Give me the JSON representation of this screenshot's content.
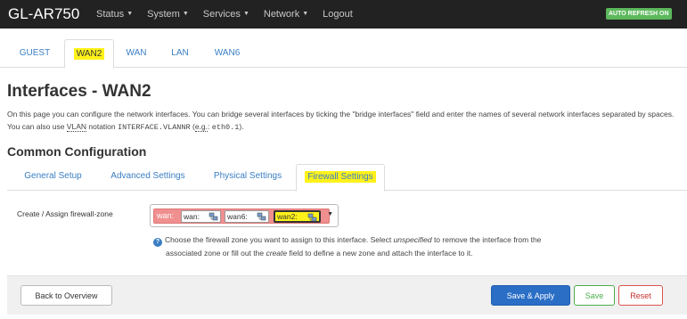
{
  "navbar": {
    "brand": "GL-AR750",
    "menu": [
      {
        "label": "Status",
        "dropdown": true
      },
      {
        "label": "System",
        "dropdown": true
      },
      {
        "label": "Services",
        "dropdown": true
      },
      {
        "label": "Network",
        "dropdown": true
      },
      {
        "label": "Logout",
        "dropdown": false
      }
    ],
    "auto_refresh": "AUTO REFRESH ON"
  },
  "interface_tabs": [
    {
      "label": "GUEST",
      "active": false
    },
    {
      "label": "WAN2",
      "active": true
    },
    {
      "label": "WAN",
      "active": false
    },
    {
      "label": "LAN",
      "active": false
    },
    {
      "label": "WAN6",
      "active": false
    }
  ],
  "page": {
    "title": "Interfaces - WAN2",
    "desc_part1": "On this page you can configure the network interfaces. You can bridge several interfaces by ticking the \"bridge interfaces\" field and enter the names of several network interfaces separated by spaces. You can also use ",
    "desc_vlan": "VLAN",
    "desc_part2": " notation ",
    "desc_notation": "INTERFACE.VLANNR",
    "desc_part3": " (",
    "desc_eg": "e.g.",
    "desc_part4": ": ",
    "desc_example": "eth0.1",
    "desc_part5": ")."
  },
  "section": {
    "title": "Common Configuration",
    "tabs": [
      {
        "label": "General Setup",
        "active": false
      },
      {
        "label": "Advanced Settings",
        "active": false
      },
      {
        "label": "Physical Settings",
        "active": false
      },
      {
        "label": "Firewall Settings",
        "active": true
      }
    ]
  },
  "firewall": {
    "label": "Create / Assign firewall-zone",
    "zone_name": "wan:",
    "interfaces": [
      "wan:",
      "wan6:",
      "wan2:"
    ],
    "selected_interface": "wan2:",
    "network_icon": "network-interface-icon",
    "help_icon": "info-icon",
    "help_a": "Choose the firewall zone you want to assign to this interface. Select ",
    "help_unspecified": "unspecified",
    "help_b": " to remove the interface from the",
    "help_c": "associated zone or fill out the ",
    "help_create": "create",
    "help_d": " field to define a new zone and attach the interface to it."
  },
  "footer": {
    "back": "Back to Overview",
    "save_apply": "Save & Apply",
    "save": "Save",
    "reset": "Reset"
  },
  "colors": {
    "navbar": "#222222",
    "link": "#3a7ec4",
    "highlight": "#fff21a",
    "zone_chip": "#f08f8f",
    "primary": "#2a6ec6",
    "success": "#4cae4c",
    "danger": "#d9534f",
    "auto_refresh": "#5cb85c"
  }
}
